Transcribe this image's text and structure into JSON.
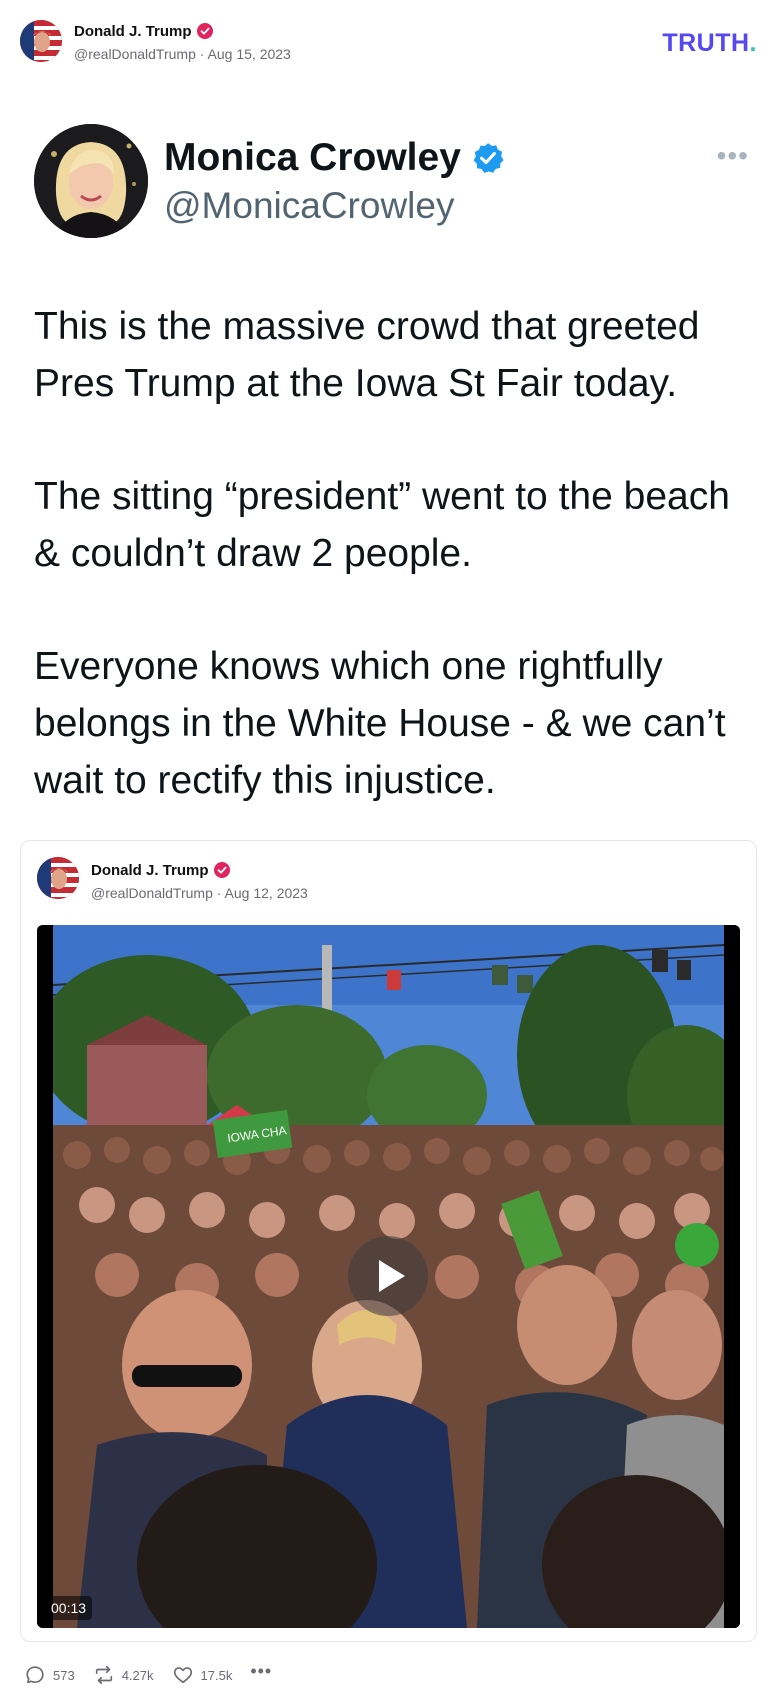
{
  "post": {
    "author_name": "Donald J. Trump",
    "handle": "@realDonaldTrump",
    "date": "Aug 15, 2023",
    "separator": "·"
  },
  "brand": {
    "logo_text": "TRUTH",
    "logo_dot": ".",
    "logo_color": "#5448ee",
    "dot_color": "#2ec4b6"
  },
  "quoted_screenshot": {
    "name": "Monica Crowley",
    "handle": "@MonicaCrowley",
    "paragraphs": [
      "This is the massive crowd that greeted Pres Trump at the Iowa St Fair today.",
      "The sitting “president” went to the beach & couldn’t draw 2 people.",
      "Everyone knows which one rightfully belongs in the White House - & we can’t wait to rectify this injustice."
    ],
    "more_icon": "more-horizontal-icon"
  },
  "retruth": {
    "author_name": "Donald J. Trump",
    "handle": "@realDonaldTrump",
    "date": "Aug 12, 2023",
    "separator": "·",
    "video": {
      "duration": "00:13",
      "sign_text": "IOWA CHA"
    }
  },
  "actions": {
    "replies": "573",
    "retruths": "4.27k",
    "likes": "17.5k",
    "more": "•••"
  },
  "colors": {
    "verified_badge": "#e0245e",
    "x_verified": "#1d9bf0",
    "muted_text": "#6b6b75"
  }
}
